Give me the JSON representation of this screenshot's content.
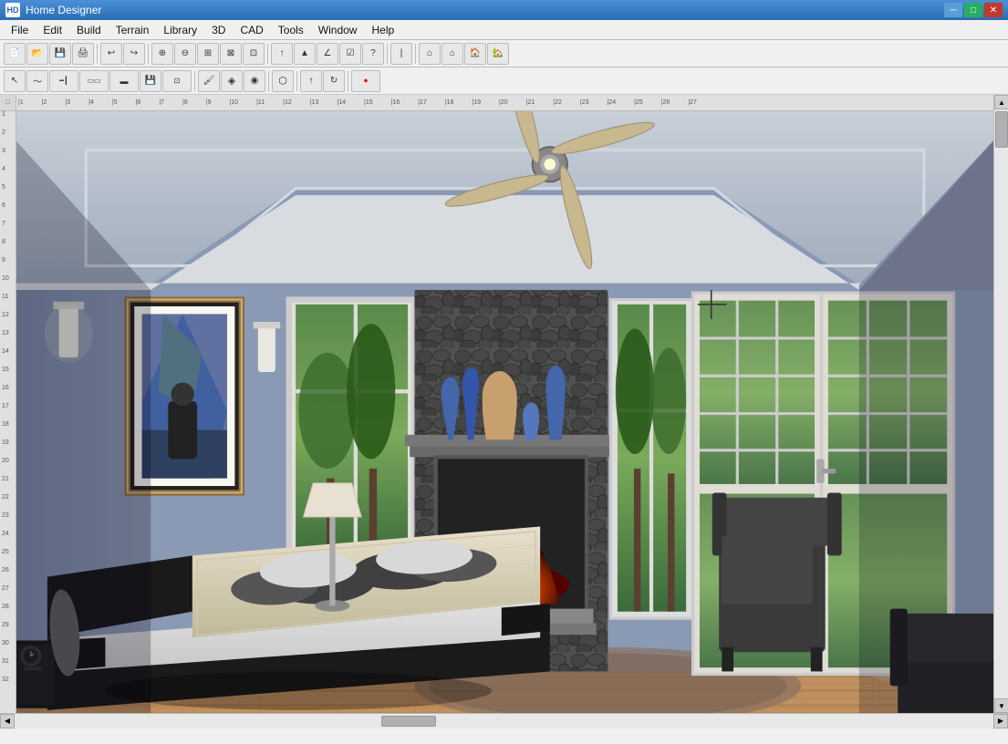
{
  "app": {
    "title": "Home Designer",
    "icon": "HD"
  },
  "window_controls": {
    "minimize": "─",
    "maximize": "□",
    "close": "✕"
  },
  "menu": {
    "items": [
      {
        "id": "file",
        "label": "File"
      },
      {
        "id": "edit",
        "label": "Edit"
      },
      {
        "id": "build",
        "label": "Build"
      },
      {
        "id": "terrain",
        "label": "Terrain"
      },
      {
        "id": "library",
        "label": "Library"
      },
      {
        "id": "3d",
        "label": "3D"
      },
      {
        "id": "cad",
        "label": "CAD"
      },
      {
        "id": "tools",
        "label": "Tools"
      },
      {
        "id": "window",
        "label": "Window"
      },
      {
        "id": "help",
        "label": "Help"
      }
    ]
  },
  "toolbar1": {
    "buttons": [
      {
        "id": "new",
        "icon": "📄",
        "label": "New"
      },
      {
        "id": "open",
        "icon": "📂",
        "label": "Open"
      },
      {
        "id": "save",
        "icon": "💾",
        "label": "Save"
      },
      {
        "id": "print",
        "icon": "🖨",
        "label": "Print"
      },
      {
        "id": "undo",
        "icon": "↩",
        "label": "Undo"
      },
      {
        "id": "redo",
        "icon": "↪",
        "label": "Redo"
      },
      {
        "id": "zoom-in",
        "icon": "⊕",
        "label": "Zoom In"
      },
      {
        "id": "zoom-out",
        "icon": "⊖",
        "label": "Zoom Out"
      },
      {
        "id": "fit",
        "icon": "⊞",
        "label": "Fit"
      },
      {
        "id": "pan",
        "icon": "✋",
        "label": "Pan"
      },
      {
        "id": "arrow-up",
        "icon": "↑",
        "label": "Arrow Up"
      },
      {
        "id": "symbol",
        "icon": "☆",
        "label": "Symbol"
      },
      {
        "id": "help",
        "icon": "?",
        "label": "Help"
      },
      {
        "id": "measure",
        "icon": "📏",
        "label": "Measure"
      },
      {
        "id": "roof1",
        "icon": "⌂",
        "label": "Roof 1"
      },
      {
        "id": "roof2",
        "icon": "⌂",
        "label": "Roof 2"
      },
      {
        "id": "roof3",
        "icon": "⌂",
        "label": "Roof 3"
      },
      {
        "id": "roof4",
        "icon": "⌂",
        "label": "Roof 4"
      }
    ]
  },
  "toolbar2": {
    "buttons": [
      {
        "id": "select",
        "icon": "↖",
        "label": "Select"
      },
      {
        "id": "polyline",
        "icon": "〜",
        "label": "Polyline"
      },
      {
        "id": "wall",
        "icon": "⊟",
        "label": "Wall"
      },
      {
        "id": "door",
        "icon": "▭",
        "label": "Door"
      },
      {
        "id": "cabinet",
        "icon": "▬",
        "label": "Cabinet"
      },
      {
        "id": "save2",
        "icon": "💾",
        "label": "Save"
      },
      {
        "id": "dimension",
        "icon": "↔",
        "label": "Dimension"
      },
      {
        "id": "paint",
        "icon": "🖌",
        "label": "Paint"
      },
      {
        "id": "color",
        "icon": "🎨",
        "label": "Color"
      },
      {
        "id": "material",
        "icon": "◈",
        "label": "Material"
      },
      {
        "id": "lamp",
        "icon": "💡",
        "label": "Lamp"
      },
      {
        "id": "arrow",
        "icon": "↑",
        "label": "Arrow"
      },
      {
        "id": "rotate",
        "icon": "↻",
        "label": "Rotate"
      },
      {
        "id": "rec",
        "icon": "⏺",
        "label": "Record"
      }
    ]
  },
  "scene": {
    "description": "3D bedroom view with fireplace, bed, and french doors",
    "ceiling_color": "#b0b8c8",
    "wall_color": "#8a9ab5",
    "floor_color": "#c8a07a",
    "fireplace_wall_color": "#555",
    "bed_frame_color": "#222",
    "bed_sheets_color": "#e8e8e8",
    "crosshair_visible": true
  },
  "statusbar": {
    "text": ""
  }
}
